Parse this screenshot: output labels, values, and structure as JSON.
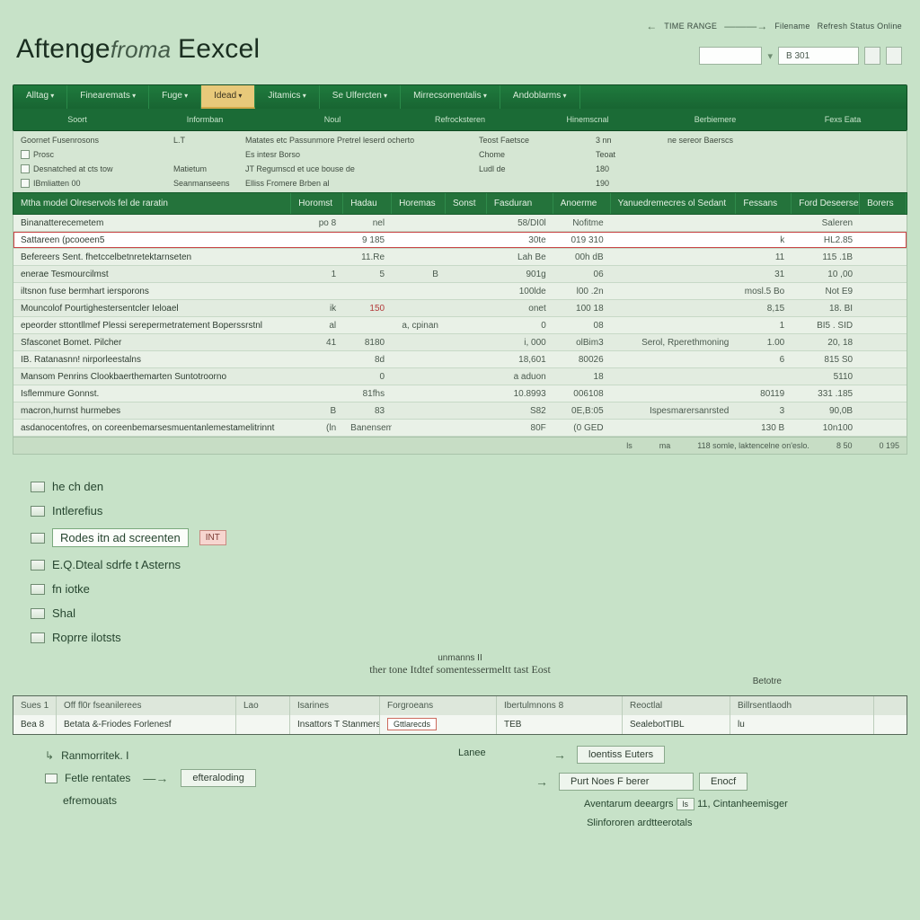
{
  "header": {
    "title_a": "Aftenge",
    "title_b": "froma",
    "title_c": "Eexcel",
    "top_label_a": "TIME RANGE",
    "top_label_b": "Filename",
    "top_label_c": "Refresh Status Online",
    "input_a": "",
    "input_b": "B 301",
    "input_c": ""
  },
  "ribbon": {
    "tabs": [
      {
        "label": "Alltag"
      },
      {
        "label": "Finearemats"
      },
      {
        "label": "Fuge"
      },
      {
        "label": "Idead"
      },
      {
        "label": "Jitamics"
      },
      {
        "label": "Se Ulfercten"
      },
      {
        "label": "Mirrecsomentalis"
      },
      {
        "label": "Andoblarms"
      }
    ],
    "sel_index": 3,
    "labels": [
      "Soort",
      "Informban",
      "Noul",
      "Refrocksteren",
      "Hinemscnal",
      "Berbiemere",
      "Fexs Eata"
    ]
  },
  "strip": [
    {
      "a": "Goornet Fusenrosons",
      "b": "L.T",
      "c": "Matates etc Passunmore Pretrel leserd ocherto",
      "d": "Teost Faetsce",
      "e": "3 nn",
      "f": "ne sereor Baerscs"
    },
    {
      "a": "Prosc",
      "b": "",
      "c": "Es  intesr  Borso",
      "d": "Chome",
      "e": "Teoat",
      "f": ""
    },
    {
      "a": "Desnatched at cts tow",
      "b": "Matietum",
      "c": "JT  Regumscd   et uce bouse de",
      "d": "Ludl de",
      "e": "180",
      "f": ""
    },
    {
      "a": "IBmliatten 00",
      "b": "Seanmanseens",
      "c": "Elliss  Fromere Brben al",
      "d": "",
      "e": "190",
      "f": ""
    }
  ],
  "table": {
    "headers": [
      "Mtha model Olreservols fel de raratin",
      "Horomst",
      "Hadau",
      "Horemas",
      "Sonst",
      "Fasduran",
      "Anoerme",
      "Yanuedremecres ol Sedant",
      "Fessans",
      "Ford Deseerses",
      "Borers"
    ],
    "rows": [
      {
        "c0": "Binanatterecemetem",
        "c1": "po 8",
        "c2": "nel",
        "c3": "",
        "c4": "",
        "c5": "58/DI0l",
        "c6": "Nofitme",
        "c7": "",
        "c8": "",
        "c9": "Saleren",
        "c10": ""
      },
      {
        "c0": "Sattareen (pcooeen5",
        "c1": "",
        "c2": "9 185",
        "c3": "",
        "c4": "",
        "c5": "30te",
        "c6": "019 310",
        "c7": "",
        "c8": "k",
        "c9": "HL2.85",
        "c10": "",
        "hl": true
      },
      {
        "c0": "Befereers Sent. fhetccelbetnretektarnseten",
        "c1": "",
        "c2": "11.Re",
        "c3": "",
        "c4": "",
        "c5": "Lah Be",
        "c6": "00h dB",
        "c7": "",
        "c8": "11",
        "c9": "115 .1B",
        "c10": ""
      },
      {
        "c0": "enerae Tesmourcilmst",
        "c1": "1",
        "c2": "5",
        "c3": "B",
        "c4": "",
        "c5": "901g",
        "c6": "06",
        "c7": "",
        "c8": "31",
        "c9": "10 ,00",
        "c10": ""
      },
      {
        "c0": "iltsnon fuse bermhart iersporons",
        "c1": "",
        "c2": "",
        "c3": "",
        "c4": "",
        "c5": "100lde",
        "c6": "l00 .2n",
        "c7": "",
        "c8": "mosl.5 Bo",
        "c9": "Not E9",
        "c10": ""
      },
      {
        "c0": "Mouncolof Pourtighestersentcler Ieloael",
        "c1": "ik",
        "c2": "150",
        "c3": "",
        "c4": "",
        "c5": "onet",
        "c6": "100 18",
        "c7": "",
        "c8": "8,15",
        "c9": "18. BI",
        "c10": "",
        "red": true
      },
      {
        "c0": "epeorder sttontllmef Plessi serepermetratement Boperssrstnl",
        "c1": "al",
        "c2": "",
        "c3": "a, cpinan",
        "c4": "",
        "c5": "0",
        "c6": "08",
        "c7": "",
        "c8": "1",
        "c9": "BI5 . SID",
        "c10": ""
      },
      {
        "c0": "Sfasconet Bomet. Pilcher",
        "c1": "41",
        "c2": "8180",
        "c3": "",
        "c4": "",
        "c5": "i, 000",
        "c6": "olBim3",
        "c7": "Serol, Rperethmoning",
        "c8": "1.00",
        "c9": "20, 18",
        "c10": ""
      },
      {
        "c0": "IB. Ratanasnn! nirporleestalns",
        "c1": "",
        "c2": "8d",
        "c3": "",
        "c4": "",
        "c5": "18,601",
        "c6": "80026",
        "c7": "",
        "c8": "6",
        "c9": "815 S0",
        "c10": ""
      },
      {
        "c0": "Mansom Penrins Clookbaerthemarten Suntotroorno",
        "c1": "",
        "c2": "0",
        "c3": "",
        "c4": "",
        "c5": "a aduon",
        "c6": "18",
        "c7": "",
        "c8": "",
        "c9": "5110",
        "c10": ""
      },
      {
        "c0": "Isflemmure Gonnst.",
        "c1": "",
        "c2": "81fhs",
        "c3": "",
        "c4": "",
        "c5": "10.8993",
        "c6": "006108",
        "c7": "",
        "c8": "80119",
        "c9": "331 .185",
        "c10": ""
      },
      {
        "c0": "macron,hurnst hurmebes",
        "c1": "B",
        "c2": "83",
        "c3": "",
        "c4": "",
        "c5": "S82",
        "c6": "0E,B:05",
        "c7": "Ispesmarersanrsted",
        "c8": "3",
        "c9": "90,0B",
        "c10": ""
      },
      {
        "c0": "asdanocentofres, on coreenbemarsesmuentanlemestamelitrinnt",
        "c1": "(ln",
        "c2": "Banensemerturtt",
        "c3": "",
        "c4": "",
        "c5": "80F",
        "c6": "(0 GED",
        "c7": "",
        "c8": "130 B",
        "c9": "10n100",
        "c10": ""
      }
    ],
    "footer": {
      "a": "ls",
      "b": "ma",
      "c": "118  somle, laktencelne on'eslo.",
      "d": "8 50",
      "e": "0 195"
    }
  },
  "nav": [
    {
      "label": "he ch den"
    },
    {
      "label": "Intlerefius"
    },
    {
      "label": "Rodes itn ad screenten",
      "selected": true,
      "tag": "INT"
    },
    {
      "label": "E.Q.Dteal sdrfe t Asterns"
    },
    {
      "label": "fn iotke"
    },
    {
      "label": "Shal"
    },
    {
      "label": "Roprre ilotsts"
    }
  ],
  "mid": {
    "a": "unmanns II",
    "b": "ther tone Itdtef somentessermeltt tast Eost",
    "c": "Betotre"
  },
  "sheets": {
    "headers": [
      "Sues 1",
      "Off fl0r fseanilerees",
      "Lao",
      "Isarines",
      "Forgroeans",
      "Ibertulmnons 8",
      "Reoctlal",
      "Billrsentlaodh"
    ],
    "row": {
      "a": "Bea 8",
      "b": "Betata &-Friodes Forlenesf",
      "c": "",
      "d": "Insattors T Stanmers",
      "e": "Gttlarecds",
      "f": "TEB",
      "g": "SealebotTIBL",
      "h": "lu"
    }
  },
  "flow": {
    "left": [
      {
        "label": "Ranmorritek. I",
        "icon": true
      },
      {
        "label": "Fetle rentates",
        "icon": true,
        "tag": "efteraloding"
      },
      {
        "label": "efremouats",
        "icon": false
      }
    ],
    "center_top": "Lanee",
    "right_top": "loentiss Euters",
    "right_mid": "Purt Noes F berer",
    "right_mid_tag": "Enocf",
    "down1": "Aventarum deeargrs",
    "down1_tags": [
      "ls",
      "11,",
      "Cintanheemisger"
    ],
    "down2": "Slinfororen ardtteerotals"
  },
  "colors": {
    "accent": "#1b6b36",
    "highlight": "#c94545"
  }
}
